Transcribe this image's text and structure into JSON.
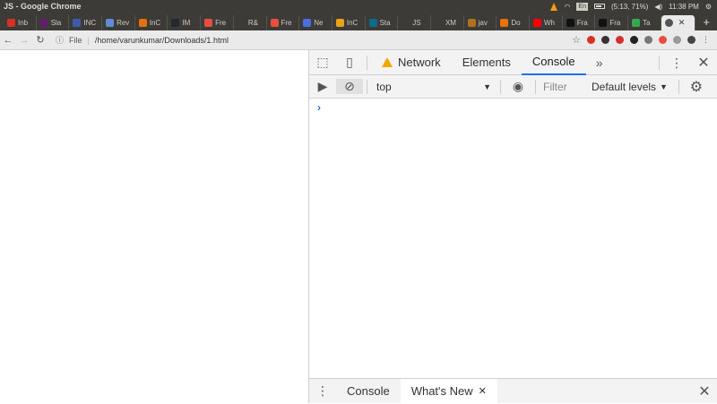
{
  "os": {
    "window_title": "JS - Google Chrome",
    "tray": {
      "lang": "En",
      "battery": "(5:13, 71%)",
      "clock": "11:38 PM"
    }
  },
  "tabs": [
    {
      "label": "Inb",
      "color": "#d93025"
    },
    {
      "label": "Sla",
      "color": "#611f69"
    },
    {
      "label": "INC",
      "color": "#3b5cad"
    },
    {
      "label": "Rev",
      "color": "#5f8dd3"
    },
    {
      "label": "InC",
      "color": "#e8710a"
    },
    {
      "label": "IM",
      "color": "#24292e"
    },
    {
      "label": "Fre",
      "color": "#e94e3c"
    },
    {
      "label": "R&",
      "color": "#3c3b37"
    },
    {
      "label": "Fre",
      "color": "#e94e3c"
    },
    {
      "label": "Ne",
      "color": "#4a6ee0"
    },
    {
      "label": "InC",
      "color": "#e8a317"
    },
    {
      "label": "Sta",
      "color": "#0b6b8a"
    },
    {
      "label": "JS",
      "color": "#3c3b37"
    },
    {
      "label": "XM",
      "color": "#3c3b37"
    },
    {
      "label": "jav",
      "color": "#b07219"
    },
    {
      "label": "Do",
      "color": "#e8710a"
    },
    {
      "label": "Wh",
      "color": "#ff0000"
    },
    {
      "label": "Fra",
      "color": "#111111"
    },
    {
      "label": "Fra",
      "color": "#111111"
    },
    {
      "label": "Ta",
      "color": "#34a853"
    }
  ],
  "toolbar": {
    "scheme": "File",
    "url": "/home/varunkumar/Downloads/1.html",
    "extensions": [
      "#d93025",
      "#333333",
      "#d32f2f",
      "#222222",
      "#777777",
      "#e94e3c",
      "#999999"
    ]
  },
  "devtools": {
    "tabs": {
      "network": "Network",
      "elements": "Elements",
      "console": "Console"
    },
    "context": "top",
    "filter_placeholder": "Filter",
    "levels": "Default levels",
    "prompt": "›"
  },
  "drawer": {
    "console": "Console",
    "whats_new": "What's New"
  },
  "colors": {
    "accent": "#1a73e8",
    "warning": "#f2a600"
  }
}
